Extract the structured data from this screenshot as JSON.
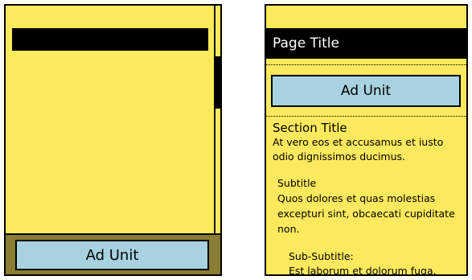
{
  "left_phone": {
    "ad_unit_label": "Ad Unit"
  },
  "right_phone": {
    "page_title": "Page Title",
    "ad_unit_label": "Ad Unit",
    "section": {
      "title": "Section Title",
      "body": "At vero eos et accusamus et iusto odio dignissimos ducimus."
    },
    "subsection": {
      "title": "Subtitle",
      "body": "Quos dolores et quas molestias excepturi sint, obcaecati cupiditate non."
    },
    "subsubsection": {
      "title": "Sub-Subtitle:",
      "body": "Est laborum et dolorum fuga."
    }
  },
  "colors": {
    "page_background": "#fde95e",
    "ad_background": "#a8d2df",
    "ad_frame": "#8a7d34",
    "bars": "#000000"
  }
}
